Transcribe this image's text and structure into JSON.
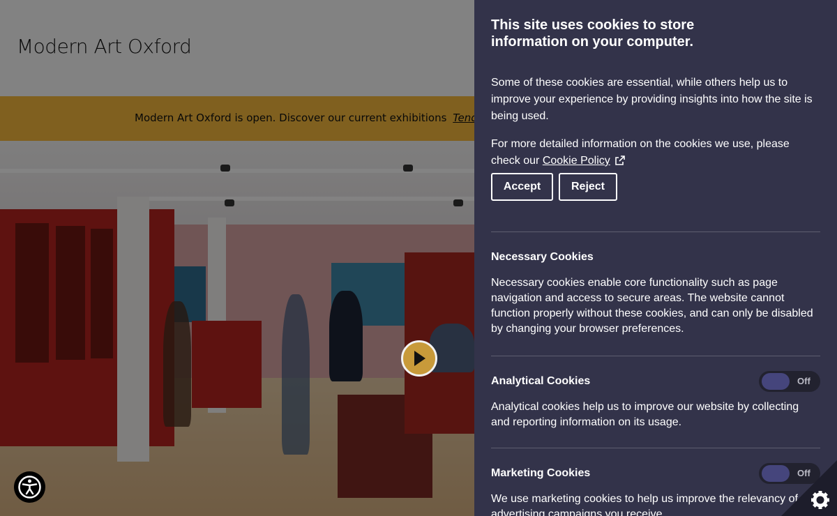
{
  "site": {
    "logo_text": "Modern Art Oxford",
    "banner_text": "Modern Art Oxford is open. Discover our current exhibitions",
    "banner_link": "Tender"
  },
  "hero": {
    "play_icon": "play-icon"
  },
  "accessibility": {
    "icon": "accessibility-person-icon"
  },
  "cookie_panel": {
    "title": "This site uses cookies to store information on your computer.",
    "intro": "Some of these cookies are essential, while others help us to improve your experience by providing insights into how the site is being used.",
    "policy_prefix": "For more detailed information on the cookies we use, please check our",
    "policy_link": "Cookie Policy",
    "accept_label": "Accept",
    "reject_label": "Reject",
    "sections": [
      {
        "title": "Necessary Cookies",
        "text": "Necessary cookies enable core functionality such as page navigation and access to secure areas. The website cannot function properly without these cookies, and can only be disabled by changing your browser preferences."
      },
      {
        "title": "Analytical Cookies",
        "text": "Analytical cookies help us to improve our website by collecting and reporting information on its usage.",
        "toggle_state": "Off"
      },
      {
        "title": "Marketing Cookies",
        "text": "We use marketing cookies to help us improve the relevancy of advertising campaigns you receive.",
        "toggle_state": "Off"
      }
    ],
    "corner_icon": "gear-icon"
  },
  "colors": {
    "panel_bg": "#33334a",
    "banner_bg": "#f5b93c",
    "toggle_knob": "#45457c",
    "play_button": "#c89a3a"
  }
}
